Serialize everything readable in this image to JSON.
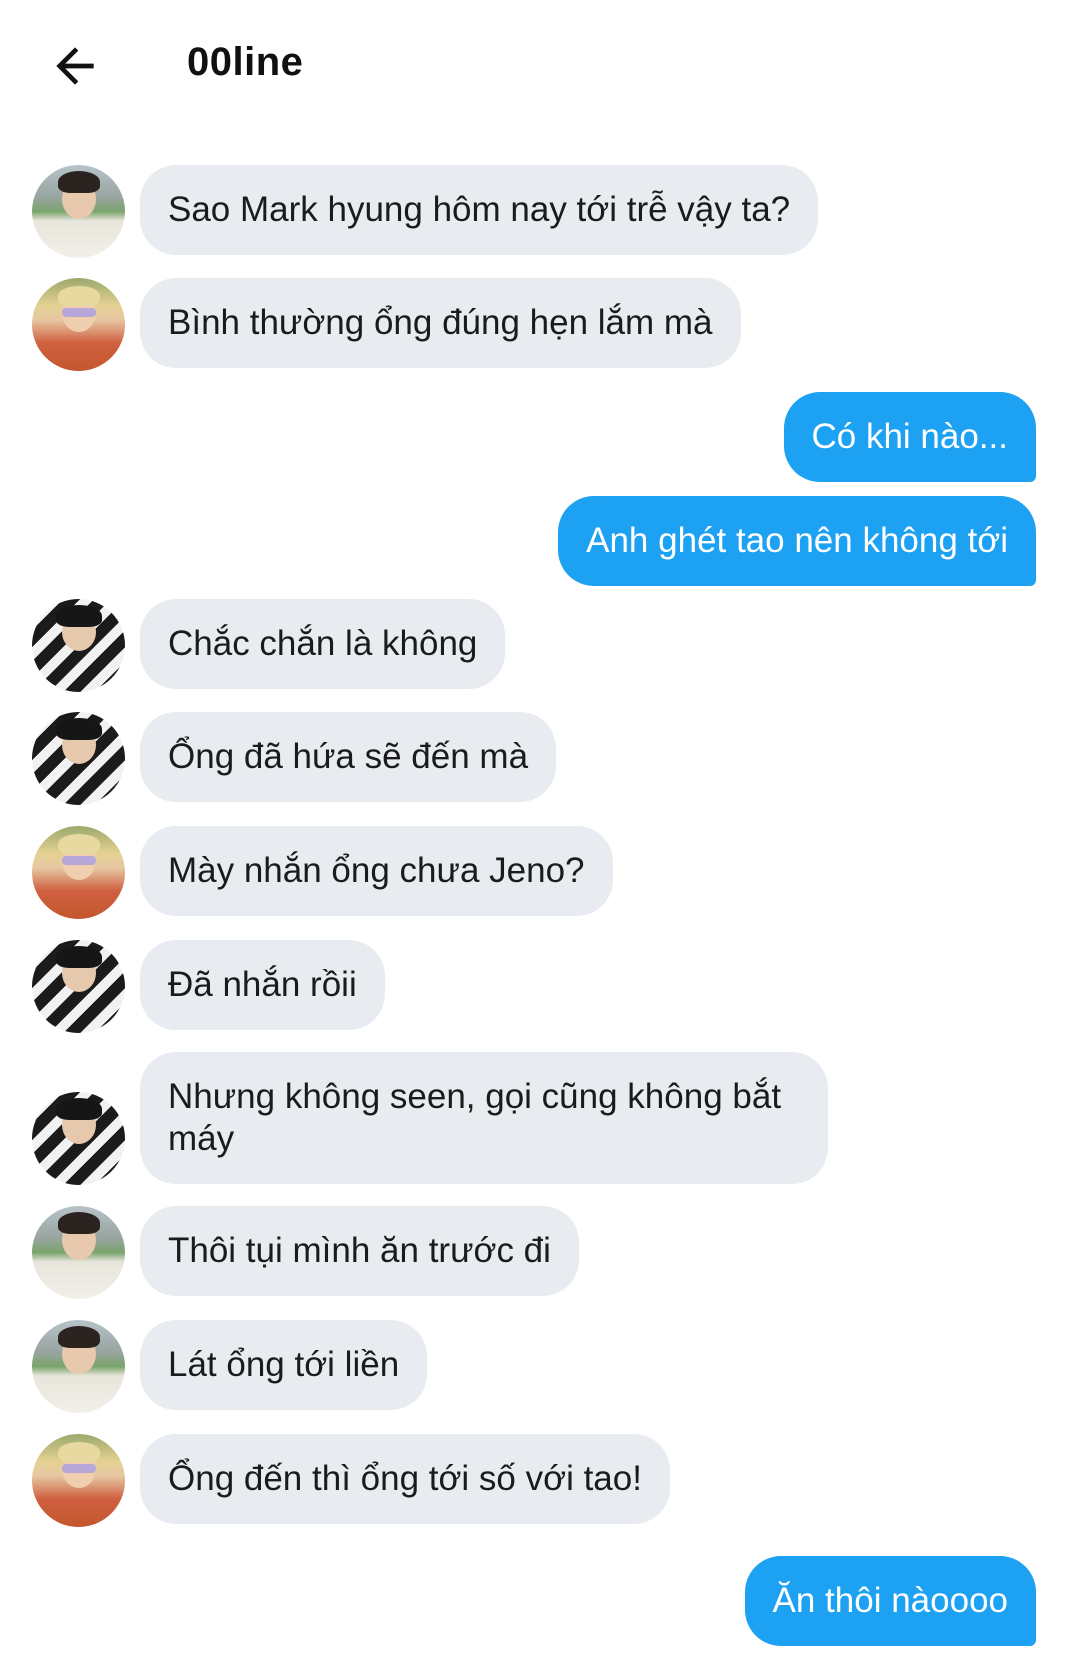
{
  "header": {
    "title": "00line",
    "back_icon": "arrow-left-icon"
  },
  "colors": {
    "incoming_bubble": "#e8ecf0",
    "outgoing_bubble": "#1da1f2",
    "incoming_text": "#1b1b1b",
    "outgoing_text": "#ffffff"
  },
  "messages": [
    {
      "direction": "incoming",
      "avatar": "avatar-boy-white-shirt",
      "text": "Sao Mark hyung hôm nay tới trễ vậy ta?"
    },
    {
      "direction": "incoming",
      "avatar": "avatar-blonde-sunglasses",
      "text": "Bình thường ổng đúng hẹn lắm mà"
    },
    {
      "direction": "outgoing",
      "text": "Có khi nào..."
    },
    {
      "direction": "outgoing",
      "text": "Anh ghét tao nên không tới"
    },
    {
      "direction": "incoming",
      "avatar": "avatar-striped-shirt",
      "text": "Chắc chắn là không"
    },
    {
      "direction": "incoming",
      "avatar": "avatar-striped-shirt",
      "text": "Ổng đã hứa sẽ đến mà"
    },
    {
      "direction": "incoming",
      "avatar": "avatar-blonde-sunglasses",
      "text": "Mày nhắn ổng chưa Jeno?"
    },
    {
      "direction": "incoming",
      "avatar": "avatar-striped-shirt",
      "text": "Đã nhắn rồii"
    },
    {
      "direction": "incoming",
      "avatar": "avatar-striped-shirt",
      "text": "Nhưng không seen, gọi cũng không bắt máy"
    },
    {
      "direction": "incoming",
      "avatar": "avatar-boy-white-shirt",
      "text": "Thôi tụi mình ăn trước đi"
    },
    {
      "direction": "incoming",
      "avatar": "avatar-boy-white-shirt",
      "text": "Lát ổng tới liền"
    },
    {
      "direction": "incoming",
      "avatar": "avatar-blonde-sunglasses",
      "text": "Ổng đến thì ổng tới số với tao!"
    },
    {
      "direction": "outgoing",
      "text": "Ăn thôi nàoooo"
    }
  ]
}
